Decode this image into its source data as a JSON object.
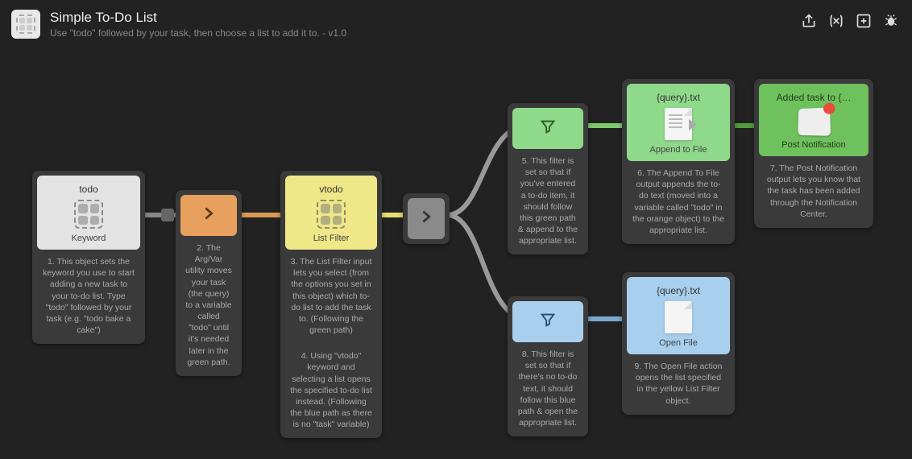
{
  "header": {
    "title": "Simple To-Do List",
    "subtitle": "Use \"todo\" followed by your task, then choose a list to add it to. - v1.0"
  },
  "nodes": {
    "n1": {
      "title": "todo",
      "label": "Keyword",
      "desc": "1. This object sets the keyword you use to start adding a new task to your to-do list. Type \"todo\" followed by your task (e.g. \"todo bake a cake\")"
    },
    "n2": {
      "desc": "2. The Arg/Var utility moves your task (the query) to a variable called \"todo\" until it's needed later in the green path."
    },
    "n3": {
      "title": "vtodo",
      "label": "List Filter",
      "desc1": "3. The List Filter input lets you select (from the options you set in this object) which to-do list to add the task to. (Following the green path)",
      "desc2": "4. Using \"vtodo\" keyword and selecting a list opens the specified to-do list instead. (Following the blue path as there is no \"task\" variable)"
    },
    "n5": {
      "desc": "5. This filter is set so that if you've entered a to-do item, it should follow this green path & append to the appropriate list."
    },
    "n6": {
      "title": "{query}.txt",
      "label": "Append to File",
      "desc": "6. The Append To File output appends the to-do text (moved into a variable called \"todo\" in the orange object) to the appropriate list."
    },
    "n7": {
      "title": "Added task to {…",
      "label": "Post Notification",
      "desc": "7. The Post Notification output lets you know that the task has been added through the Notification Center."
    },
    "n8": {
      "desc": "8. This filter is set so that if there's no to-do text, it should follow this blue path & open the appropriate list."
    },
    "n9": {
      "title": "{query}.txt",
      "label": "Open File",
      "desc": "9. The Open File action opens the list specified in the yellow List Filter object."
    }
  }
}
